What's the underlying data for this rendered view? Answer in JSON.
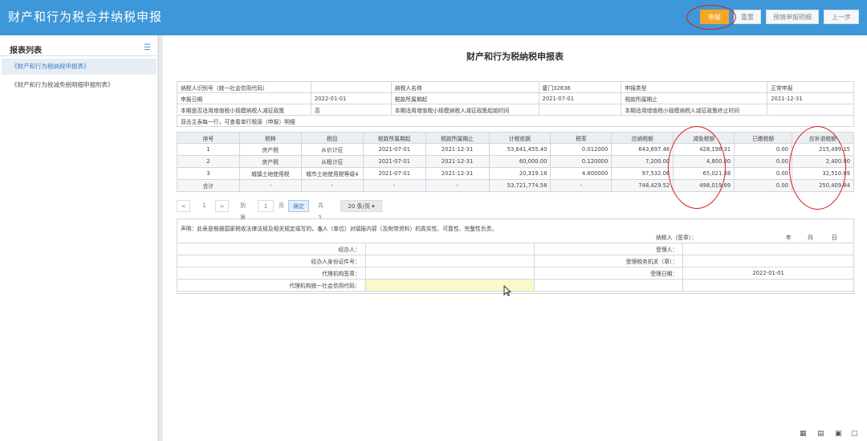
{
  "app": {
    "title": "财产和行为税合并纳税申报",
    "buttons": {
      "declare": "申报",
      "reset": "重置",
      "prefill": "预填申报明细",
      "prev": "上一步"
    }
  },
  "sidebar": {
    "title": "报表列表",
    "items": [
      {
        "label": "《财产和行为税纳税申报表》"
      },
      {
        "label": "《财产和行为税减免税明细申报附表》"
      }
    ]
  },
  "form": {
    "title": "财产和行为税纳税申报表",
    "info": {
      "taxpayer_id_label": "纳税人识别号（统一社会信用代码）",
      "taxpayer_id_value": "",
      "taxpayer_name_label": "纳税人名称",
      "taxpayer_name_value": "厦门32836",
      "declare_type_label": "申报类型",
      "declare_type_value": "正常申报",
      "declare_date_label": "申报日期",
      "declare_date_value": "2022-01-01",
      "period_start_label": "税款所属期起",
      "period_start_value": "2021-07-01",
      "period_end_label": "税款所属期止",
      "period_end_value": "2021-12-31",
      "small_policy_label": "本期是否适用增值税小规模纳税人减征政策",
      "small_policy_value": "否",
      "small_start_label": "本期适用增值税小规模纳税人减征政策起始时间",
      "small_end_label": "本期适用增值税小规模纳税人减征政策终止时间",
      "hint": "双击主表每一行，可查看单行税源（申报）明细"
    },
    "grid": {
      "headers": [
        "序号",
        "税种",
        "税目",
        "税款所属期起",
        "税款所属期止",
        "计税依据",
        "税率",
        "应纳税额",
        "减免税额",
        "已缴税额",
        "应补退税额"
      ],
      "rows": [
        [
          "1",
          "房产税",
          "从价计征",
          "2021-07-01",
          "2021-12-31",
          "53,641,455.40",
          "0.012000",
          "643,697.46",
          "428,198.31",
          "0.00",
          "215,499.15"
        ],
        [
          "2",
          "房产税",
          "从租计征",
          "2021-07-01",
          "2021-12-31",
          "60,000.00",
          "0.120000",
          "7,200.00",
          "4,800.00",
          "0.00",
          "2,400.00"
        ],
        [
          "3",
          "城镇土地使用税",
          "城市土地使用税等级4",
          "2021-07-01",
          "2021-12-31",
          "20,319.18",
          "4.800000",
          "97,532.06",
          "65,021.38",
          "0.00",
          "32,510.69"
        ]
      ],
      "total": [
        "合计",
        "-",
        "-",
        "-",
        "-",
        "53,721,774.58",
        "-",
        "748,429.52",
        "498,019.69",
        "0.00",
        "250,409.84"
      ]
    },
    "pager": {
      "prev": "<",
      "page": "1",
      "next": ">",
      "goto_label": "到第",
      "goto_value": "1",
      "page_unit": "页",
      "confirm": "确定",
      "total": "共 3 条",
      "page_size": "20 条/页"
    },
    "declaration": {
      "text": "声明：此表是根据国家税收法律法规及相关规定填写的，本人（单位）对填报内容（及附带资料）的真实性、可靠性、完整性负责。",
      "signature": "纳税人（签章）：",
      "year": "年",
      "month": "月",
      "day": "日"
    },
    "sign": {
      "handler": "经办人：",
      "handler_id": "经办人身份证件号：",
      "agent_seal": "代理机构签章：",
      "agent_code": "代理机构统一社会信用代码：",
      "acceptor": "受理人：",
      "accept_office": "受理税务机关（章）：",
      "accept_date_label": "受理日期：",
      "accept_date_value": "2022-01-01"
    }
  },
  "colors": {
    "header_bar": "#3d97d8",
    "primary_button": "#f5a623",
    "annotation_circle": "#d22020",
    "highlight_cell": "#fbf8c9"
  }
}
